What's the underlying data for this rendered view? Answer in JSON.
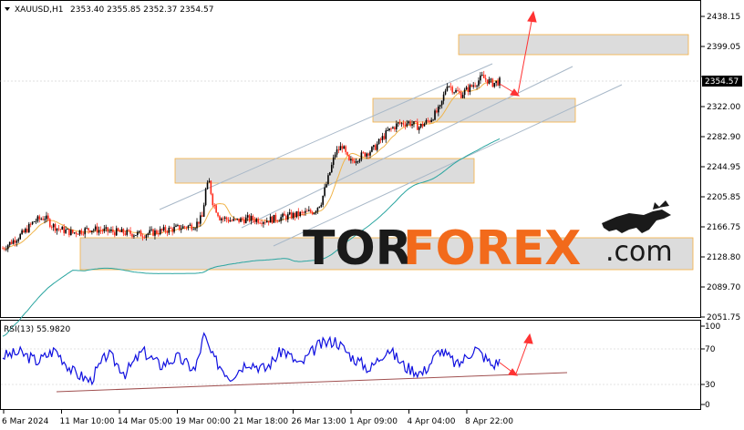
{
  "header": {
    "symbol": "XAUUSD,H1",
    "ohlc": "2353.40 2355.85 2352.37 2354.57"
  },
  "price_axis": {
    "labels": [
      "2438.15",
      "2399.05",
      "2361.10",
      "2322.00",
      "2282.90",
      "2244.95",
      "2205.85",
      "2166.75",
      "2128.80",
      "2089.70",
      "2051.75"
    ],
    "current_price": "2354.57"
  },
  "rsi_panel": {
    "title": "RSI(13) 55.9820",
    "levels": [
      "100",
      "70",
      "30",
      "0"
    ]
  },
  "time_axis": {
    "labels": [
      "6 Mar 2024",
      "11 Mar 10:00",
      "14 Mar 05:00",
      "19 Mar 00:00",
      "21 Mar 18:00",
      "26 Mar 13:00",
      "1 Apr 09:00",
      "4 Apr 04:00",
      "8 Apr 22:00"
    ]
  },
  "watermark": {
    "tor": "TOR",
    "forex": "FOREX",
    "dotcom": ".com"
  },
  "colors": {
    "bull_candle": "#000000",
    "bear_candle": "#ff2a1a",
    "ma_fast": "#f0b44a",
    "ma_slow": "#2aa5a0",
    "rsi_line": "#1010e0",
    "channel_lines": "#a8b8c8",
    "zones_fill": "#dcdcdc",
    "zones_border": "#f5b040",
    "forecast_arrows": "#ff3333",
    "rsi_trendline": "#a05050",
    "brand_orange": "#f26a1b"
  },
  "chart_data": {
    "type": "candlestick",
    "symbol": "XAUUSD",
    "timeframe": "H1",
    "last_price": 2354.57,
    "ohlc_last": {
      "open": 2353.4,
      "high": 2355.85,
      "low": 2352.37,
      "close": 2354.57
    },
    "ylim": [
      2051.75,
      2438.15
    ],
    "close_path": [
      [
        0,
        2140
      ],
      [
        6,
        2150
      ],
      [
        12,
        2160
      ],
      [
        18,
        2175
      ],
      [
        24,
        2180
      ],
      [
        28,
        2170
      ],
      [
        32,
        2165
      ],
      [
        40,
        2160
      ],
      [
        50,
        2165
      ],
      [
        60,
        2162
      ],
      [
        70,
        2160
      ],
      [
        80,
        2158
      ],
      [
        90,
        2162
      ],
      [
        100,
        2166
      ],
      [
        110,
        2170
      ],
      [
        114,
        2180
      ],
      [
        116,
        2215
      ],
      [
        118,
        2225
      ],
      [
        120,
        2200
      ],
      [
        124,
        2180
      ],
      [
        132,
        2175
      ],
      [
        140,
        2178
      ],
      [
        150,
        2176
      ],
      [
        160,
        2180
      ],
      [
        170,
        2184
      ],
      [
        178,
        2188
      ],
      [
        182,
        2200
      ],
      [
        186,
        2230
      ],
      [
        190,
        2262
      ],
      [
        194,
        2272
      ],
      [
        198,
        2250
      ],
      [
        204,
        2258
      ],
      [
        212,
        2268
      ],
      [
        220,
        2290
      ],
      [
        226,
        2300
      ],
      [
        232,
        2302
      ],
      [
        238,
        2296
      ],
      [
        244,
        2305
      ],
      [
        250,
        2320
      ],
      [
        254,
        2352
      ],
      [
        258,
        2343
      ],
      [
        262,
        2338
      ],
      [
        266,
        2345
      ],
      [
        270,
        2352
      ],
      [
        274,
        2360
      ],
      [
        280,
        2352
      ],
      [
        284,
        2354.57
      ]
    ],
    "forecast": [
      {
        "type": "arrow",
        "from_price": 2354.57,
        "to_price": 2335
      },
      {
        "type": "arrow",
        "from_price": 2335,
        "to_price": 2435
      }
    ],
    "zones": [
      {
        "low": 2392,
        "high": 2408
      },
      {
        "low": 2310,
        "high": 2330
      },
      {
        "low": 2232,
        "high": 2252
      },
      {
        "low": 2118,
        "high": 2148
      }
    ],
    "rsi": {
      "period": 13,
      "last": 55.982,
      "levels": [
        30,
        70
      ],
      "ylim": [
        0,
        100
      ],
      "series": [
        [
          0,
          62
        ],
        [
          10,
          66
        ],
        [
          20,
          55
        ],
        [
          30,
          70
        ],
        [
          40,
          42
        ],
        [
          50,
          30
        ],
        [
          60,
          65
        ],
        [
          70,
          40
        ],
        [
          80,
          68
        ],
        [
          90,
          50
        ],
        [
          100,
          60
        ],
        [
          110,
          44
        ],
        [
          115,
          88
        ],
        [
          120,
          60
        ],
        [
          130,
          35
        ],
        [
          140,
          55
        ],
        [
          150,
          45
        ],
        [
          160,
          70
        ],
        [
          170,
          50
        ],
        [
          180,
          75
        ],
        [
          190,
          82
        ],
        [
          200,
          60
        ],
        [
          210,
          45
        ],
        [
          220,
          72
        ],
        [
          230,
          48
        ],
        [
          240,
          40
        ],
        [
          250,
          70
        ],
        [
          260,
          50
        ],
        [
          270,
          72
        ],
        [
          280,
          50
        ],
        [
          284,
          55.98
        ]
      ]
    }
  }
}
